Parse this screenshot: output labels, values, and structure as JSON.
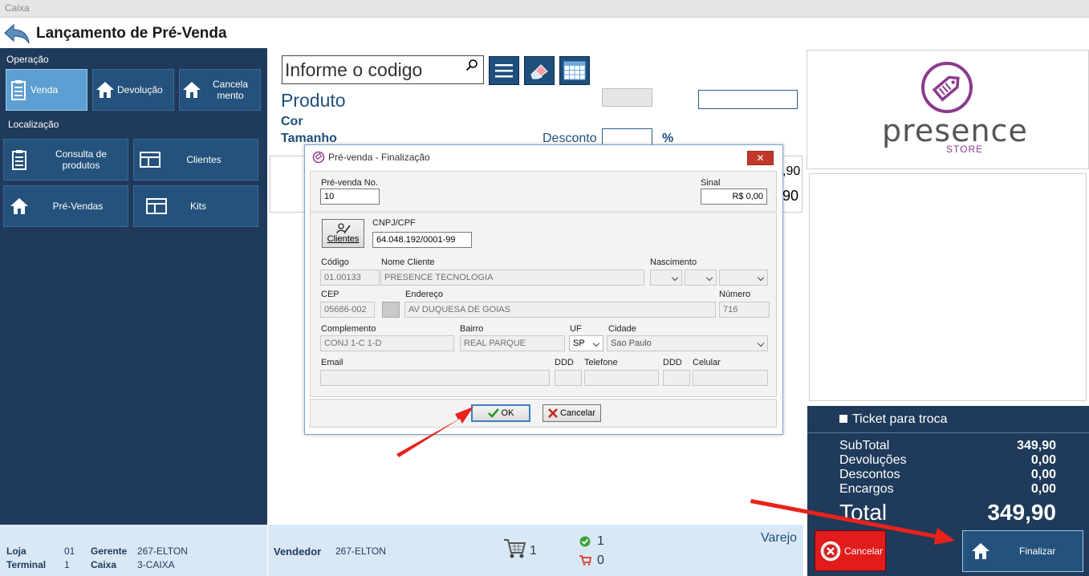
{
  "window": {
    "title": "Caixa"
  },
  "header": {
    "title": "Lançamento de Pré-Venda"
  },
  "left": {
    "operacao_label": "Operação",
    "operacao": [
      {
        "label": "Venda"
      },
      {
        "label": "Devolução"
      },
      {
        "label": "Cancela mento"
      }
    ],
    "localizacao_label": "Localização",
    "localizacao": [
      {
        "label": "Consulta de produtos"
      },
      {
        "label": "Clientes"
      },
      {
        "label": "Pré-Vendas"
      },
      {
        "label": "Kits"
      }
    ]
  },
  "center": {
    "search_placeholder": "Informe o codigo",
    "produto_label": "Produto",
    "cor_label": "Cor",
    "tamanho_label": "Tamanho",
    "desconto_label": "Desconto",
    "percent": "%",
    "partial_value_1": ",90",
    "partial_value_2": "90"
  },
  "dialog": {
    "title": "Pré-venda - Finalização",
    "close": "✕",
    "prevenda_label": "Pré-venda No.",
    "prevenda_value": "10",
    "sinal_label": "Sinal",
    "sinal_value": "R$ 0,00",
    "clientes_button": "Clientes",
    "cnpj_label": "CNPJ/CPF",
    "cnpj_value": "64.048.192/0001-99",
    "codigo_label": "Código",
    "codigo_value": "01.00133",
    "nome_label": "Nome Cliente",
    "nome_value": "PRESENCE TECNOLOGIA",
    "nascimento_label": "Nascimento",
    "cep_label": "CEP",
    "cep_value": "05686-002",
    "endereco_label": "Endereço",
    "endereco_value": "AV DUQUESA DE GOIAS",
    "numero_label": "Número",
    "numero_value": "716",
    "complemento_label": "Complemento",
    "complemento_value": "CONJ 1-C 1-D",
    "bairro_label": "Bairro",
    "bairro_value": "REAL PARQUE",
    "uf_label": "UF",
    "uf_value": "SP",
    "cidade_label": "Cidade",
    "cidade_value": "Sao Paulo",
    "email_label": "Email",
    "ddd_label": "DDD",
    "telefone_label": "Telefone",
    "ddd2_label": "DDD",
    "celular_label": "Celular",
    "ok_button": "OK",
    "cancelar_button": "Cancelar"
  },
  "right": {
    "logo_text": "presence",
    "logo_sub": "STORE",
    "ticket_label": "Ticket para troca",
    "subtotal_label": "SubTotal",
    "subtotal_value": "349,90",
    "devolucoes_label": "Devoluções",
    "devolucoes_value": "0,00",
    "descontos_label": "Descontos",
    "descontos_value": "0,00",
    "encargos_label": "Encargos",
    "encargos_value": "0,00",
    "total_label": "Total",
    "total_value": "349,90",
    "cancelar_button": "Cancelar",
    "finalizar_button": "Finalizar"
  },
  "footer": {
    "loja_label": "Loja",
    "loja_value": "01",
    "terminal_label": "Terminal",
    "terminal_value": "1",
    "gerente_label": "Gerente",
    "gerente_value": "267-ELTON",
    "caixa_label": "Caixa",
    "caixa_value": "3-CAIXA",
    "vendedor_label": "Vendedor",
    "vendedor_value": "267-ELTON",
    "cart_count": "1",
    "ok_count": "1",
    "cart2_count": "0",
    "varejo": "Varejo"
  },
  "colors": {
    "panel": "#1f3a5a",
    "tile": "#24527c",
    "accent": "#5d9fd2",
    "cancel": "#e21b1b",
    "brand": "#8b3a8f"
  }
}
